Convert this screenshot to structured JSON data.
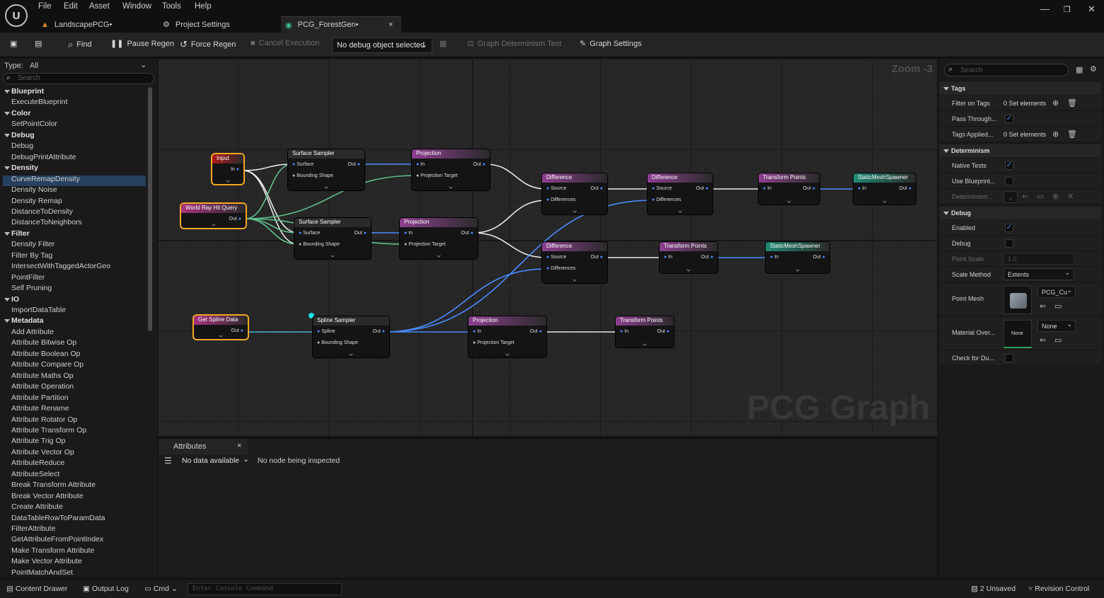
{
  "menu": [
    "File",
    "Edit",
    "Asset",
    "Window",
    "Tools",
    "Help"
  ],
  "tabs": [
    "LandscapePCG•",
    "Project Settings",
    "PCG_ForestGen•"
  ],
  "toolbar": {
    "find": "Find",
    "pause_regen": "Pause Regen",
    "force_regen": "Force Regen",
    "cancel_execution": "Cancel Execution",
    "debug_object": "No debug object selected",
    "determinism_test": "Graph Determinism Test",
    "graph_settings": "Graph Settings"
  },
  "palette": {
    "type_label": "Type:",
    "type_value": "All",
    "search_placeholder": "Search",
    "entries": [
      {
        "t": "cat",
        "label": "Blueprint"
      },
      {
        "t": "item",
        "label": "ExecuteBlueprint"
      },
      {
        "t": "cat",
        "label": "Color"
      },
      {
        "t": "item",
        "label": "SetPointColor"
      },
      {
        "t": "cat",
        "label": "Debug"
      },
      {
        "t": "item",
        "label": "Debug"
      },
      {
        "t": "item",
        "label": "DebugPrintAttribute"
      },
      {
        "t": "cat",
        "label": "Density"
      },
      {
        "t": "item",
        "label": "CurveRemapDensity",
        "selected": true
      },
      {
        "t": "item",
        "label": "Density Noise"
      },
      {
        "t": "item",
        "label": "Density Remap"
      },
      {
        "t": "item",
        "label": "DistanceToDensity"
      },
      {
        "t": "item",
        "label": "DistanceToNeighbors"
      },
      {
        "t": "cat",
        "label": "Filter"
      },
      {
        "t": "item",
        "label": "Density Filter"
      },
      {
        "t": "item",
        "label": "Filter By Tag"
      },
      {
        "t": "item",
        "label": "IntersectWithTaggedActorGeo"
      },
      {
        "t": "item",
        "label": "PointFilter"
      },
      {
        "t": "item",
        "label": "Self Pruning"
      },
      {
        "t": "cat",
        "label": "IO"
      },
      {
        "t": "item",
        "label": "ImportDataTable"
      },
      {
        "t": "cat",
        "label": "Metadata"
      },
      {
        "t": "item",
        "label": "Add Attribute"
      },
      {
        "t": "item",
        "label": "Attribute Bitwise Op"
      },
      {
        "t": "item",
        "label": "Attribute Boolean Op"
      },
      {
        "t": "item",
        "label": "Attribute Compare Op"
      },
      {
        "t": "item",
        "label": "Attribute Maths Op"
      },
      {
        "t": "item",
        "label": "Attribute Operation"
      },
      {
        "t": "item",
        "label": "Attribute Partition"
      },
      {
        "t": "item",
        "label": "Attribute Rename"
      },
      {
        "t": "item",
        "label": "Attribute Rotator Op"
      },
      {
        "t": "item",
        "label": "Attribute Transform Op"
      },
      {
        "t": "item",
        "label": "Attribute Trig Op"
      },
      {
        "t": "item",
        "label": "Attribute Vector Op"
      },
      {
        "t": "item",
        "label": "AttributeReduce"
      },
      {
        "t": "item",
        "label": "AttributeSelect"
      },
      {
        "t": "item",
        "label": "Break Transform Attribute"
      },
      {
        "t": "item",
        "label": "Break Vector Attribute"
      },
      {
        "t": "item",
        "label": "Create Attribute"
      },
      {
        "t": "item",
        "label": "DataTableRowToParamData"
      },
      {
        "t": "item",
        "label": "FilterAttribute"
      },
      {
        "t": "item",
        "label": "GetAttributeFromPointIndex"
      },
      {
        "t": "item",
        "label": "Make Transform Attribute"
      },
      {
        "t": "item",
        "label": "Make Vector Attribute"
      },
      {
        "t": "item",
        "label": "PointMatchAndSet"
      }
    ]
  },
  "graph": {
    "zoom": "Zoom -3",
    "watermark": "PCG Graph",
    "nodes": [
      {
        "title": "Input",
        "color": "#b01818",
        "selected": true,
        "inputs": [],
        "outputs": [
          "In"
        ]
      },
      {
        "title": "World Ray Hit Query",
        "color": "#a7337f",
        "selected": true,
        "inputs": [],
        "outputs": [
          "Out"
        ]
      },
      {
        "title": "Get Spline Data",
        "color": "#a7337f",
        "selected": true,
        "inputs": [],
        "outputs": [
          "Out"
        ]
      },
      {
        "title": "Surface Sampler",
        "color": "#2b2b2b",
        "inputs": [
          "Surface",
          "Bounding Shape"
        ],
        "outputs": [
          "Out"
        ]
      },
      {
        "title": "Surface Sampler",
        "color": "#2b2b2b",
        "inputs": [
          "Surface",
          "Bounding Shape"
        ],
        "outputs": [
          "Out"
        ]
      },
      {
        "title": "Spline Sampler",
        "color": "#2b2b2b",
        "inputs": [
          "Spline",
          "Bounding Shape"
        ],
        "outputs": [
          "Out"
        ]
      },
      {
        "title": "Projection",
        "color": "#8d3f8f",
        "inputs": [
          "In",
          "Projection Target"
        ],
        "outputs": [
          "Out"
        ]
      },
      {
        "title": "Projection",
        "color": "#8d3f8f",
        "inputs": [
          "In",
          "Projection Target"
        ],
        "outputs": [
          "Out"
        ]
      },
      {
        "title": "Projection",
        "color": "#8d3f8f",
        "inputs": [
          "In",
          "Projection Target"
        ],
        "outputs": [
          "Out"
        ]
      },
      {
        "title": "Difference",
        "color": "#8d3f8f",
        "inputs": [
          "Source",
          "Differences"
        ],
        "outputs": [
          "Out"
        ]
      },
      {
        "title": "Difference",
        "color": "#8d3f8f",
        "inputs": [
          "Source",
          "Differences"
        ],
        "outputs": [
          "Out"
        ]
      },
      {
        "title": "Difference",
        "color": "#8d3f8f",
        "inputs": [
          "Source",
          "Differences"
        ],
        "outputs": [
          "Out"
        ]
      },
      {
        "title": "Transform Points",
        "color": "#8d3f8f",
        "inputs": [
          "In"
        ],
        "outputs": [
          "Out"
        ]
      },
      {
        "title": "Transform Points",
        "color": "#8d3f8f",
        "inputs": [
          "In"
        ],
        "outputs": [
          "Out"
        ]
      },
      {
        "title": "Transform Points",
        "color": "#8d3f8f",
        "inputs": [
          "In"
        ],
        "outputs": [
          "Out"
        ]
      },
      {
        "title": "StaticMeshSpawner",
        "color": "#1f8a73",
        "inputs": [
          "In"
        ],
        "outputs": [
          "Out"
        ]
      },
      {
        "title": "StaticMeshSpawner",
        "color": "#1f8a73",
        "inputs": [
          "In"
        ],
        "outputs": [
          "Out"
        ]
      }
    ]
  },
  "attributes": {
    "tab": "Attributes",
    "data_select": "No data available",
    "status": "No node being inspected"
  },
  "details": {
    "search_placeholder": "Search",
    "tags": {
      "header": "Tags",
      "filter_on_tags": "Filter on Tags",
      "filter_value": "0 Set elements",
      "pass_through": "Pass Through...",
      "tags_applied": "Tags Applied...",
      "tags_value": "0 Set elements"
    },
    "determinism": {
      "header": "Determinism",
      "native_tests": "Native Tests",
      "use_blueprint": "Use Blueprint...",
      "determinism": "Determinism..."
    },
    "debug": {
      "header": "Debug",
      "enabled": "Enabled",
      "debug": "Debug",
      "point_scale": "Point Scale",
      "point_scale_value": "1.0",
      "scale_method": "Scale Method",
      "scale_method_value": "Extents",
      "point_mesh": "Point Mesh",
      "point_mesh_value": "PCG_Cu",
      "material_override": "Material Over...",
      "material_value": "None",
      "material_thumb": "None",
      "check_dup": "Check for Du..."
    }
  },
  "statusbar": {
    "content_drawer": "Content Drawer",
    "output_log": "Output Log",
    "cmd": "Cmd",
    "console_placeholder": "Enter Console Command",
    "unsaved": "2 Unsaved",
    "revision_control": "Revision Control"
  }
}
